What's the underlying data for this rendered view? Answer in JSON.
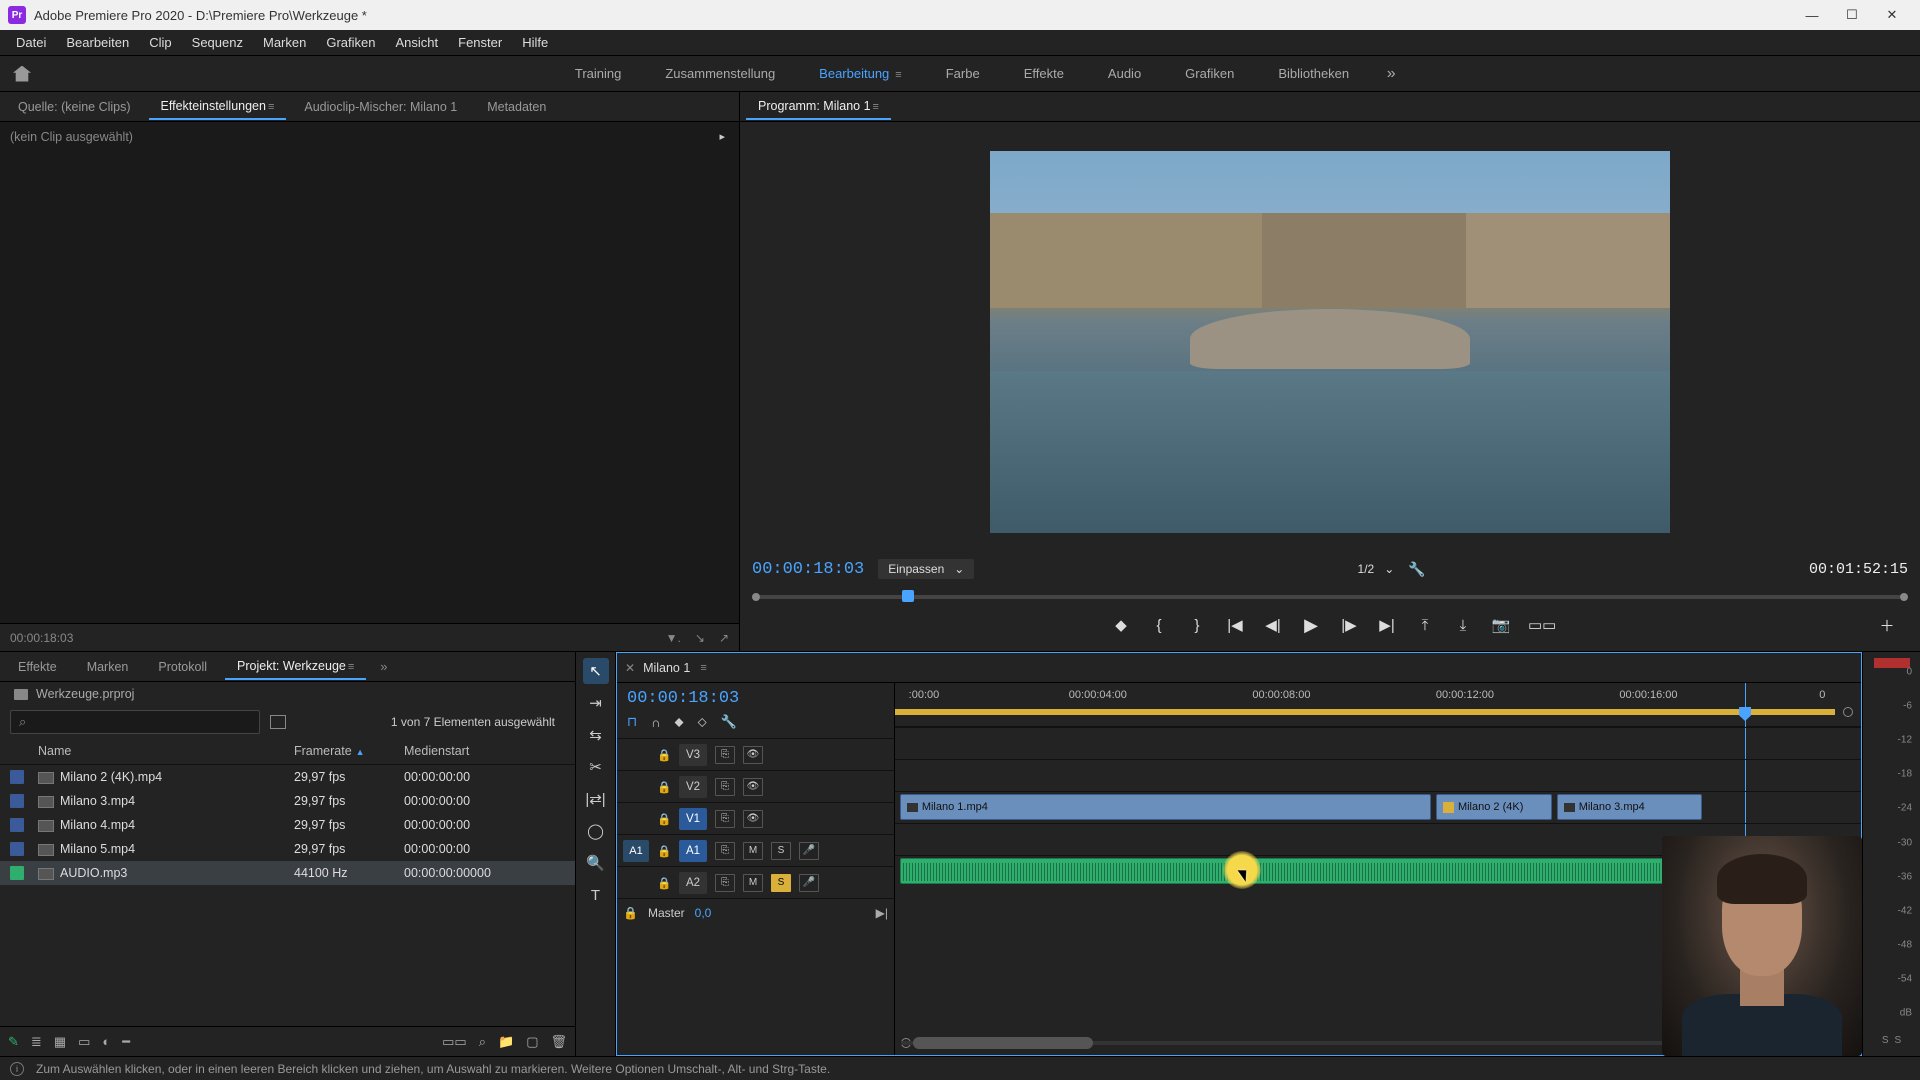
{
  "titlebar": {
    "app_abbrev": "Pr",
    "title": "Adobe Premiere Pro 2020 - D:\\Premiere Pro\\Werkzeuge *"
  },
  "menu": {
    "items": [
      "Datei",
      "Bearbeiten",
      "Clip",
      "Sequenz",
      "Marken",
      "Grafiken",
      "Ansicht",
      "Fenster",
      "Hilfe"
    ]
  },
  "workspaces": {
    "items": [
      "Training",
      "Zusammenstellung",
      "Bearbeitung",
      "Farbe",
      "Effekte",
      "Audio",
      "Grafiken",
      "Bibliotheken"
    ],
    "active_index": 2
  },
  "source_tabs": {
    "items": [
      "Quelle: (keine Clips)",
      "Effekteinstellungen",
      "Audioclip-Mischer: Milano 1",
      "Metadaten"
    ],
    "active_index": 1
  },
  "effect_controls": {
    "no_clip": "(kein Clip ausgewählt)",
    "timecode": "00:00:18:03"
  },
  "program": {
    "tab": "Programm: Milano 1",
    "tc_current": "00:00:18:03",
    "fit_label": "Einpassen",
    "zoom_label": "1/2",
    "tc_total": "00:01:52:15"
  },
  "project_tabs": {
    "items": [
      "Effekte",
      "Marken",
      "Protokoll",
      "Projekt: Werkzeuge"
    ],
    "active_index": 3
  },
  "project": {
    "file": "Werkzeuge.prproj",
    "selection": "1 von 7 Elementen ausgewählt",
    "columns": {
      "name": "Name",
      "framerate": "Framerate",
      "mediastart": "Medienstart"
    },
    "rows": [
      {
        "chip": "video",
        "name": "Milano 2 (4K).mp4",
        "framerate": "29,97 fps",
        "mediastart": "00:00:00:00",
        "selected": false
      },
      {
        "chip": "video",
        "name": "Milano 3.mp4",
        "framerate": "29,97 fps",
        "mediastart": "00:00:00:00",
        "selected": false
      },
      {
        "chip": "video",
        "name": "Milano 4.mp4",
        "framerate": "29,97 fps",
        "mediastart": "00:00:00:00",
        "selected": false
      },
      {
        "chip": "video",
        "name": "Milano 5.mp4",
        "framerate": "29,97 fps",
        "mediastart": "00:00:00:00",
        "selected": false
      },
      {
        "chip": "audio",
        "name": "AUDIO.mp3",
        "framerate": "44100 Hz",
        "mediastart": "00:00:00:00000",
        "selected": true
      }
    ]
  },
  "timeline": {
    "sequence": "Milano 1",
    "tc": "00:00:18:03",
    "ruler": [
      ":00:00",
      "00:00:04:00",
      "00:00:08:00",
      "00:00:12:00",
      "00:00:16:00",
      "0"
    ],
    "master_label": "Master",
    "master_value": "0,0",
    "tracks": {
      "v3": "V3",
      "v2": "V2",
      "v1": "V1",
      "a1": "A1",
      "a2": "A2",
      "src_a1": "A1"
    },
    "clips": {
      "v1a": "Milano 1.mp4",
      "v1b": "Milano 2 (4K)",
      "v1c": "Milano 3.mp4"
    },
    "toggles": {
      "m": "M",
      "s": "S",
      "mic": "●"
    }
  },
  "meters": {
    "labels": [
      "0",
      "-6",
      "-12",
      "-18",
      "-24",
      "-30",
      "-36",
      "-42",
      "-48",
      "-54",
      "dB"
    ],
    "foot": {
      "s1": "S",
      "s2": "S"
    }
  },
  "status": {
    "text": "Zum Auswählen klicken, oder in einen leeren Bereich klicken und ziehen, um Auswahl zu markieren. Weitere Optionen Umschalt-, Alt- und Strg-Taste."
  },
  "icons": {
    "hamburger": "≡",
    "chev_down": "⌄",
    "chev_right": "▸",
    "chev_dbl": "»",
    "search": "⌕",
    "wrench": "🔧",
    "play": "▶",
    "step_back": "◀",
    "step_fwd": "▶",
    "goto_in": "|◀",
    "goto_out": "▶|",
    "frame_back": "◀|",
    "frame_fwd": "|▶",
    "mark_in": "{",
    "mark_out": "}",
    "marker": "◆",
    "lift": "⤒",
    "extract": "⤓",
    "export": "⎙",
    "camera": "📷",
    "plus": "＋",
    "magnet": "⊔",
    "link": "⌇",
    "marker2": "⬥",
    "spanner": "✎",
    "sel": "▲",
    "track_sel": "➤",
    "ripple": "✂",
    "slip": "⇄",
    "pen": "○",
    "hand": "✋",
    "zoom": "🔍",
    "type": "T",
    "lock": "🔒",
    "sync": "⎘",
    "eye": "👁",
    "mic": "🎤",
    "pencil": "✎",
    "list": "≣",
    "grid": "▦",
    "freeform": "▭",
    "sort": "◐",
    "slider": "━",
    "bin": "🗑",
    "newitem": "▢",
    "folder": "📁",
    "minimize": "—",
    "maximize": "☐",
    "close": "✕"
  }
}
